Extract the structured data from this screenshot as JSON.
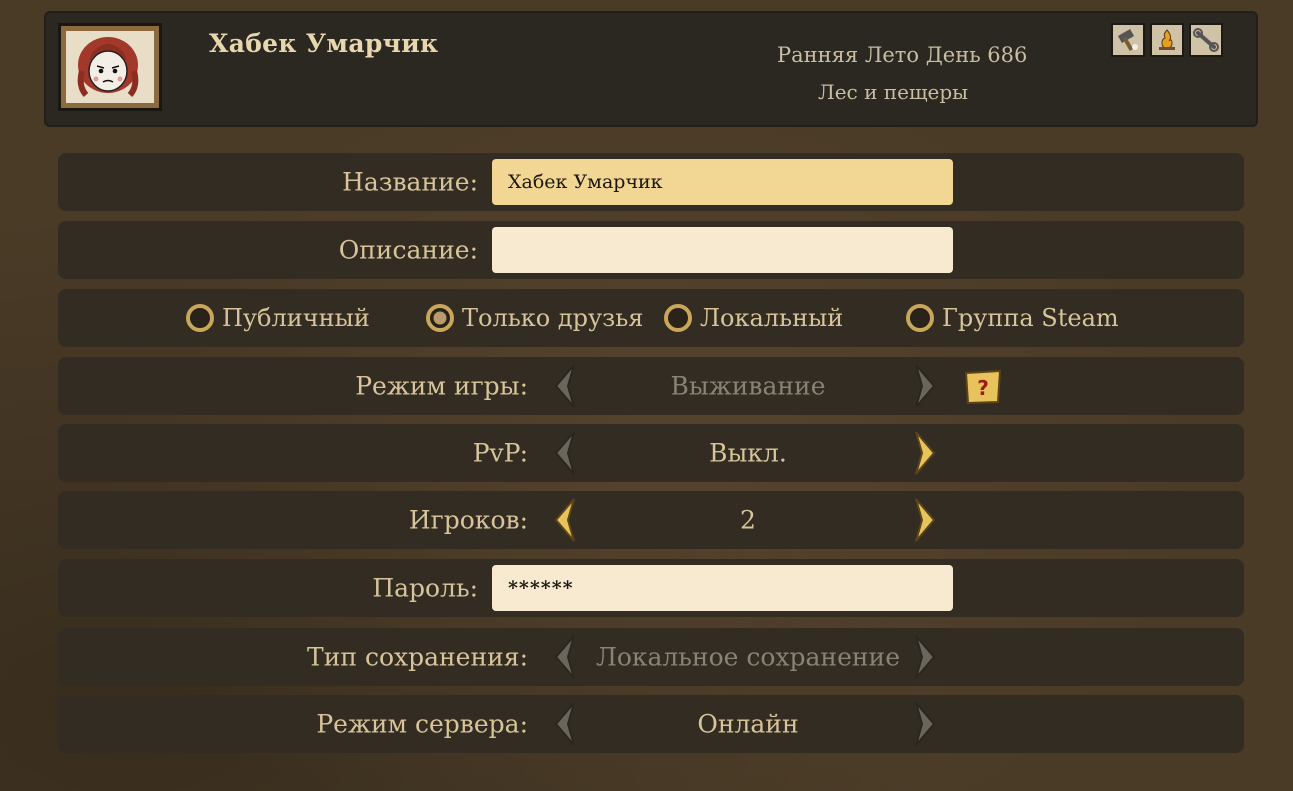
{
  "header": {
    "title": "Хабек Умарчик",
    "season": "Ранняя Лето День 686",
    "world": "Лес и пещеры",
    "icons": [
      "hammer-icon",
      "campfire-icon",
      "wrench-icon"
    ]
  },
  "form": {
    "name": {
      "label": "Название:",
      "value": "Хабек Умарчик"
    },
    "description": {
      "label": "Описание:",
      "value": ""
    },
    "privacy": {
      "options": [
        "Публичный",
        "Только друзья",
        "Локальный",
        "Группа Steam"
      ],
      "selected": "Только друзья"
    },
    "game_mode": {
      "label": "Режим игры:",
      "value": "Выживание"
    },
    "pvp": {
      "label": "PvP:",
      "value": "Выкл."
    },
    "players": {
      "label": "Игроков:",
      "value": "2"
    },
    "password": {
      "label": "Пароль:",
      "value": "******"
    },
    "save_type": {
      "label": "Тип сохранения:",
      "value": "Локальное сохранение"
    },
    "server_mode": {
      "label": "Режим сервера:",
      "value": "Онлайн"
    }
  },
  "colors": {
    "accent_gold": "#e8c25c",
    "disabled_gray": "#8a8272",
    "text": "#d8c49a"
  }
}
